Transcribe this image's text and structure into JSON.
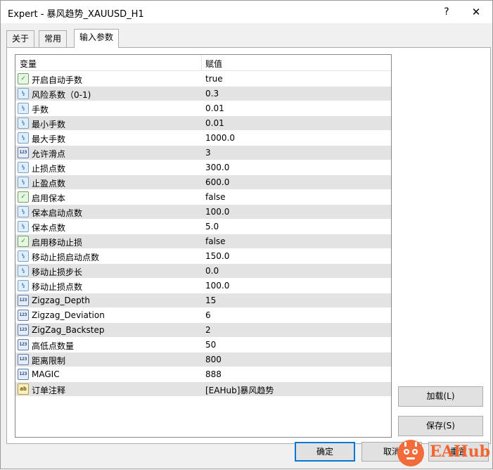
{
  "window": {
    "title": "Expert - 暴风趋势_XAUUSD_H1",
    "help_label": "?",
    "close_label": "✕"
  },
  "tabs": [
    {
      "label": "关于"
    },
    {
      "label": "常用"
    },
    {
      "label": "输入参数"
    }
  ],
  "grid": {
    "col_variable": "变量",
    "col_value": "赋值",
    "rows": [
      {
        "name": "开启自动手数",
        "value": "true",
        "icon": "bool-icon"
      },
      {
        "name": "风险系数（0-1)",
        "value": "0.3",
        "icon": "double-icon"
      },
      {
        "name": "手数",
        "value": "0.01",
        "icon": "double-icon"
      },
      {
        "name": "最小手数",
        "value": "0.01",
        "icon": "double-icon"
      },
      {
        "name": "最大手数",
        "value": "1000.0",
        "icon": "double-icon"
      },
      {
        "name": "允许滑点",
        "value": "3",
        "icon": "int-icon"
      },
      {
        "name": "止损点数",
        "value": "300.0",
        "icon": "double-icon"
      },
      {
        "name": "止盈点数",
        "value": "600.0",
        "icon": "double-icon"
      },
      {
        "name": "启用保本",
        "value": "false",
        "icon": "bool-icon"
      },
      {
        "name": "保本启动点数",
        "value": "100.0",
        "icon": "double-icon"
      },
      {
        "name": "保本点数",
        "value": "5.0",
        "icon": "double-icon"
      },
      {
        "name": "启用移动止损",
        "value": "false",
        "icon": "bool-icon"
      },
      {
        "name": "移动止损启动点数",
        "value": "150.0",
        "icon": "double-icon"
      },
      {
        "name": "移动止损步长",
        "value": "0.0",
        "icon": "double-icon"
      },
      {
        "name": "移动止损点数",
        "value": "100.0",
        "icon": "double-icon"
      },
      {
        "name": "Zigzag_Depth",
        "value": "15",
        "icon": "int-icon"
      },
      {
        "name": "Zigzag_Deviation",
        "value": "6",
        "icon": "int-icon"
      },
      {
        "name": "ZigZag_Backstep",
        "value": "2",
        "icon": "int-icon"
      },
      {
        "name": "高低点数量",
        "value": "50",
        "icon": "int-icon"
      },
      {
        "name": "距离限制",
        "value": "800",
        "icon": "int-icon"
      },
      {
        "name": "MAGIC",
        "value": "888",
        "icon": "int-icon"
      },
      {
        "name": "订单注释",
        "value": "[EAHub]暴风趋势",
        "icon": "string-icon"
      }
    ]
  },
  "buttons": {
    "load": "加载(L)",
    "save": "保存(S)",
    "ok": "确定",
    "cancel": "取消",
    "reset": "重置"
  },
  "watermark": {
    "text": "EAHub",
    "color": "#f26531"
  }
}
